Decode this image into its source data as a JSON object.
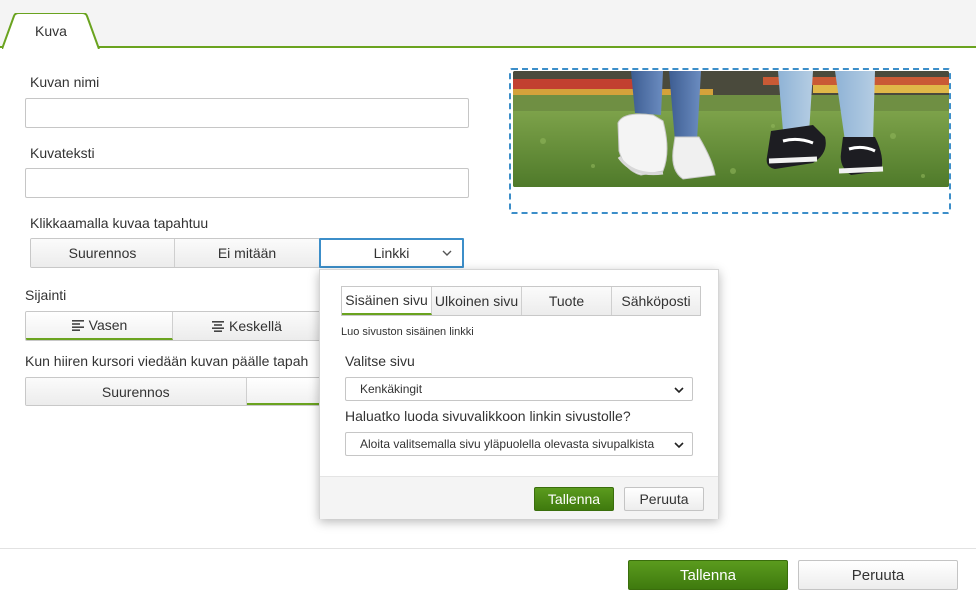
{
  "tab": {
    "label": "Kuva"
  },
  "form": {
    "name_label": "Kuvan nimi",
    "name_value": "",
    "caption_label": "Kuvateksti",
    "caption_value": "",
    "click_label": "Klikkaamalla kuvaa tapahtuu",
    "click_options": [
      "Suurennos",
      "Ei mitään",
      "Linkki"
    ],
    "position_label": "Sijainti",
    "position_options": [
      "Vasen",
      "Keskellä"
    ],
    "hover_label": "Kun hiiren kursori viedään kuvan päälle tapah",
    "hover_options": [
      "Suurennos"
    ]
  },
  "popup": {
    "tabs": [
      "Sisäinen sivu",
      "Ulkoinen sivu",
      "Tuote",
      "Sähköposti"
    ],
    "description": "Luo sivuston sisäinen linkki",
    "page_label": "Valitse sivu",
    "page_value": "Kenkäkingit",
    "menu_label": "Haluatko luoda sivuvalikkoon linkin sivustolle?",
    "menu_value": "Aloita valitsemalla sivu yläpuolella olevasta sivupalkista",
    "save": "Tallenna",
    "cancel": "Peruuta"
  },
  "footer": {
    "save": "Tallenna",
    "cancel": "Peruuta"
  },
  "colors": {
    "accent_green": "#6aa31f",
    "button_green": "#4a8716",
    "focus_blue": "#3c8ec9"
  }
}
